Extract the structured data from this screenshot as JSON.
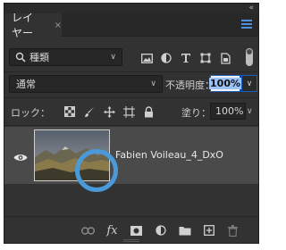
{
  "window": {
    "collapse_label": "«",
    "close_label": "×"
  },
  "tabs": [
    {
      "label": "レイヤー",
      "close": "×"
    }
  ],
  "filter": {
    "kind_value": "種類",
    "icons": [
      "image-filter-icon",
      "adjustment-filter-icon",
      "type-filter-icon",
      "shape-filter-icon",
      "smart-object-filter-icon"
    ]
  },
  "blend": {
    "mode_value": "通常",
    "opacity_label": "不透明度：",
    "opacity_value": "100%"
  },
  "lock": {
    "label": "ロック：",
    "icons": [
      "lock-transparent-icon",
      "lock-image-icon",
      "lock-position-icon",
      "lock-artboard-icon",
      "lock-all-icon"
    ],
    "fill_label": "塗り：",
    "fill_value": "100%"
  },
  "layers": [
    {
      "name": "Fabien Voileau_4_DxO",
      "visible": true,
      "type": "smart-object"
    }
  ],
  "bottom_toolbar": {
    "icons": [
      "link-layers-icon",
      "fx-icon",
      "add-mask-icon",
      "new-fill-adjustment-icon",
      "new-group-icon",
      "new-layer-icon",
      "delete-layer-icon"
    ],
    "fx_label": "fx"
  },
  "colors": {
    "accent": "#4a9ad9",
    "panel_bg": "#323232",
    "selected_row": "#4a4a4a",
    "highlight_ring": "#4a9ad9"
  }
}
